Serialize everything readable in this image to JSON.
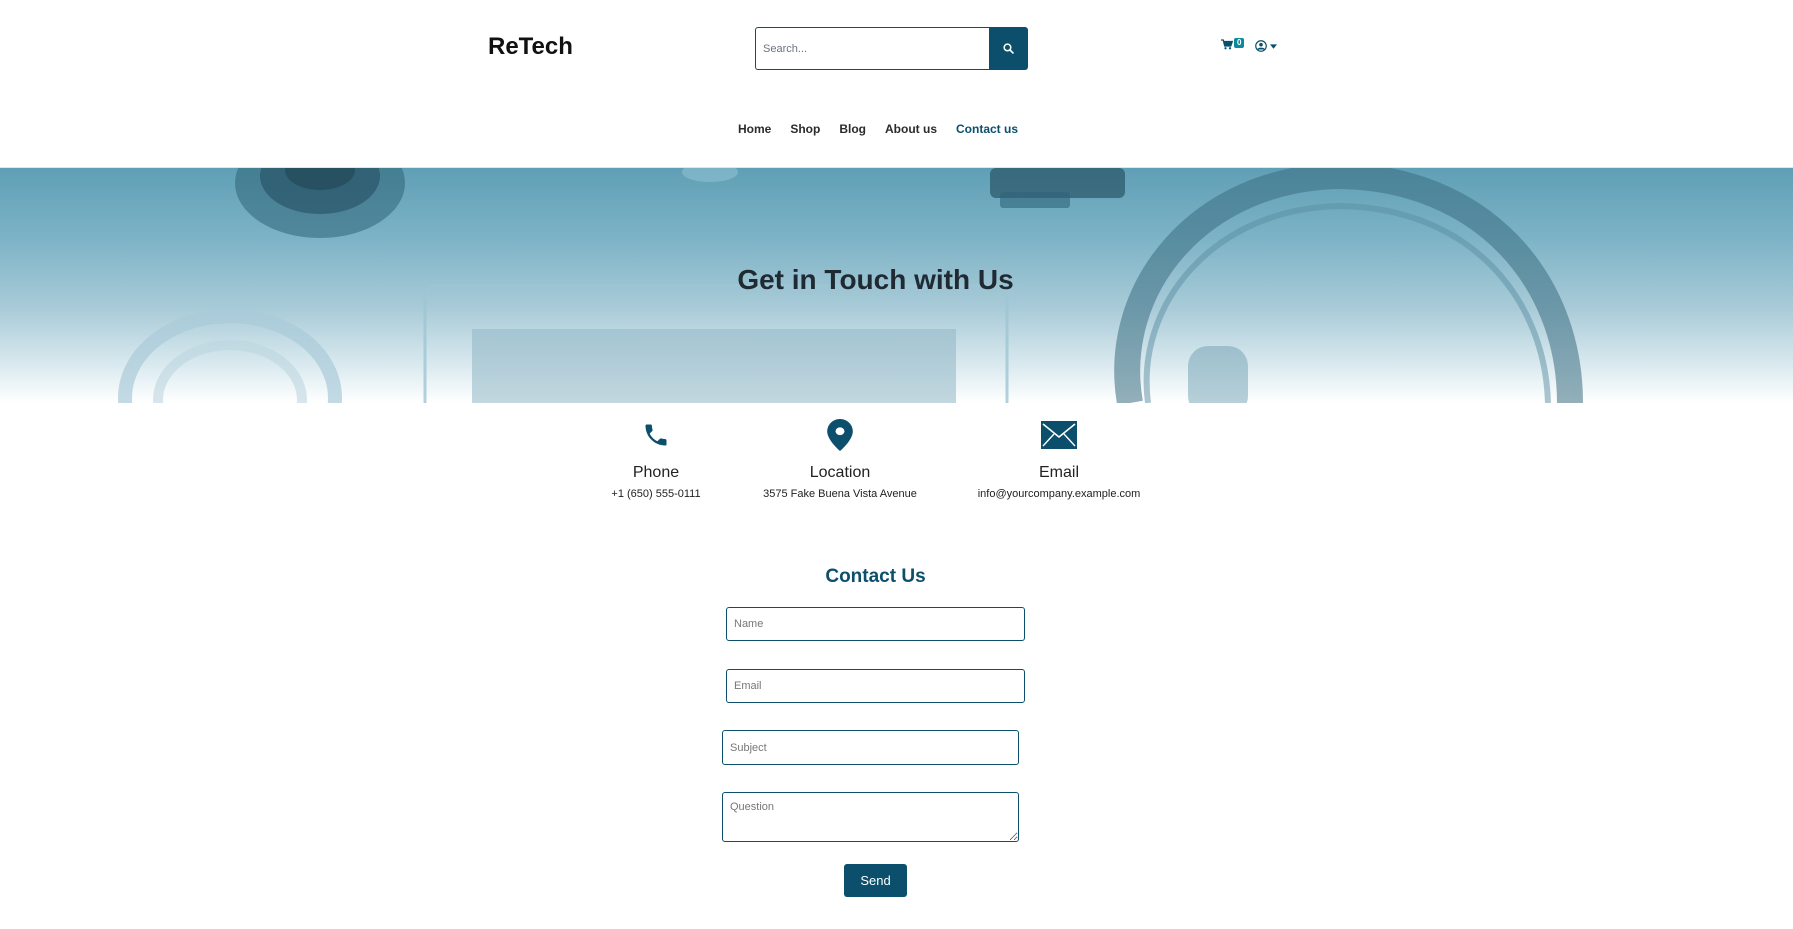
{
  "header": {
    "brand": "ReTech",
    "search_placeholder": "Search...",
    "cart_count": "0"
  },
  "nav": {
    "items": [
      {
        "label": "Home"
      },
      {
        "label": "Shop"
      },
      {
        "label": "Blog"
      },
      {
        "label": "About us"
      },
      {
        "label": "Contact us",
        "active": true
      }
    ]
  },
  "hero": {
    "title": "Get in Touch with Us"
  },
  "contact_info": [
    {
      "icon": "phone-icon",
      "label": "Phone",
      "value": "+1 (650) 555-0111"
    },
    {
      "icon": "location-pin-icon",
      "label": "Location",
      "value": "3575 Fake Buena Vista Avenue"
    },
    {
      "icon": "envelope-icon",
      "label": "Email",
      "value": "info@yourcompany.example.com"
    }
  ],
  "form": {
    "title": "Contact Us",
    "name_placeholder": "Name",
    "email_placeholder": "Email",
    "subject_placeholder": "Subject",
    "question_placeholder": "Question",
    "send_label": "Send"
  },
  "colors": {
    "primary": "#0b4f6c",
    "badge": "#0b8a9e"
  }
}
